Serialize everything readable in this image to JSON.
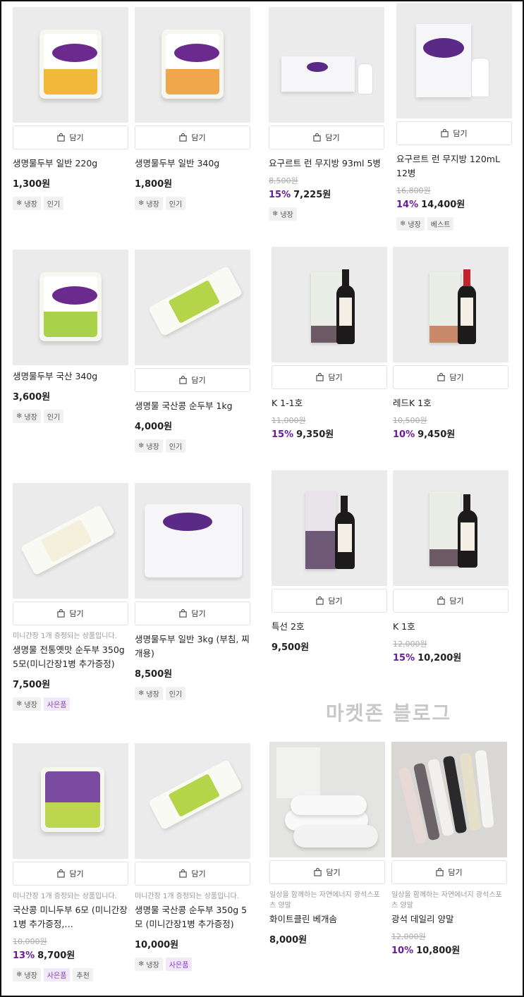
{
  "cart_label": "담기",
  "blog_watermark": "마켓존 블로그",
  "products": [
    {
      "name": "생명물두부 일반 220g",
      "price": "1,300원",
      "tags": [
        "냉장",
        "인기"
      ]
    },
    {
      "name": "생명물두부 일반 340g",
      "price": "1,800원",
      "tags": [
        "냉장",
        "인기"
      ]
    },
    {
      "name": "요구르트 런 무지방 93ml 5병",
      "original": "8,500원",
      "discount": "15%",
      "price": "7,225원",
      "tags": [
        "냉장"
      ]
    },
    {
      "name": "요구르트 런 무지방 120mL 12병",
      "original": "16,800원",
      "discount": "14%",
      "price": "14,400원",
      "tags": [
        "냉장",
        "베스트"
      ]
    },
    {
      "name": "생명물두부 국산 340g",
      "price": "3,600원",
      "tags": [
        "냉장",
        "인기"
      ]
    },
    {
      "name": "생명물 국산콩 순두부 1kg",
      "price": "4,000원",
      "tags": [
        "냉장",
        "인기"
      ]
    },
    {
      "name": "K 1-1호",
      "original": "11,000원",
      "discount": "15%",
      "price": "9,350원"
    },
    {
      "name": "레드K 1호",
      "original": "10,500원",
      "discount": "10%",
      "price": "9,450원"
    },
    {
      "desc": "미니간장 1개 증정되는 상품입니다.",
      "name": "생명물 전통옛맛 순두부 350g 5모(미니간장1병 추가증정)",
      "price": "7,500원",
      "tags": [
        "냉장",
        "사은품"
      ]
    },
    {
      "name": "생명물두부 일반 3kg (부침, 찌개용)",
      "price": "8,500원",
      "tags": [
        "냉장",
        "인기"
      ]
    },
    {
      "name": "특선 2호",
      "price": "9,500원"
    },
    {
      "name": "K 1호",
      "original": "12,000원",
      "discount": "15%",
      "price": "10,200원"
    },
    {
      "desc": "미니간장 1개 증정되는 상품입니다.",
      "name": "국산콩 미니두부 6모 (미니간장1병 추가증정,…",
      "original": "10,000원",
      "discount": "13%",
      "price": "8,700원",
      "tags": [
        "냉장",
        "사은품",
        "추천"
      ]
    },
    {
      "desc": "미니간장 1개 증정되는 상품입니다.",
      "name": "생명물 국산콩 순두부 350g 5모 (미니간장1병 추가증정)",
      "price": "10,000원",
      "tags": [
        "냉장",
        "사은품"
      ]
    },
    {
      "desc": "일상을 함께하는 자연에너지 광석스포츠 양말",
      "name": "화이트클린 베개솜",
      "price": "8,000원"
    },
    {
      "desc": "일상을 함께하는 자연에너지 광석스포츠 양말",
      "name": "광석 데일리 양말",
      "original": "12,000원",
      "discount": "10%",
      "price": "10,800원"
    }
  ]
}
